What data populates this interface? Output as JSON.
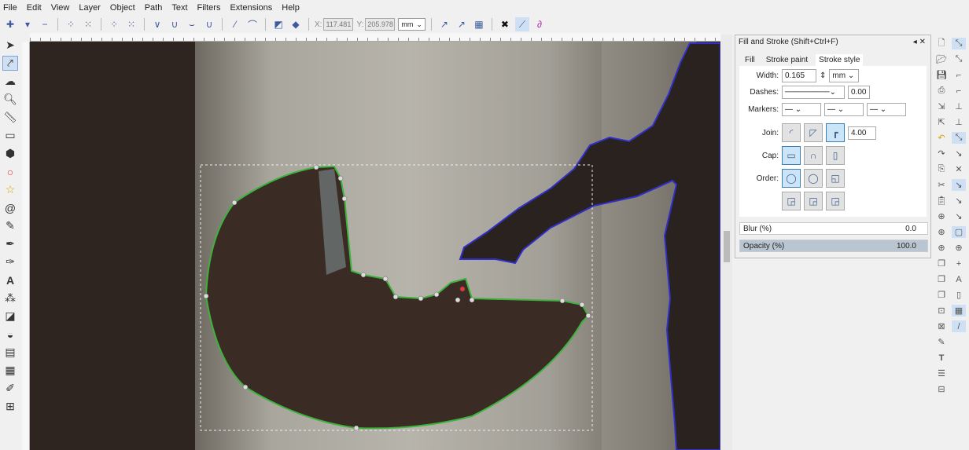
{
  "menu": [
    "File",
    "Edit",
    "View",
    "Layer",
    "Object",
    "Path",
    "Text",
    "Filters",
    "Extensions",
    "Help"
  ],
  "toolbar": {
    "x_label": "X:",
    "x_value": "117.481",
    "y_label": "Y:",
    "y_value": "205.978",
    "unit": "mm"
  },
  "panel": {
    "title": "Fill and Stroke (Shift+Ctrl+F)",
    "tabs": [
      "Fill",
      "Stroke paint",
      "Stroke style"
    ],
    "width_label": "Width:",
    "width_value": "0.165",
    "width_unit": "mm",
    "dashes_label": "Dashes:",
    "dashes_value": "0.00",
    "markers_label": "Markers:",
    "join_label": "Join:",
    "miter_value": "4.00",
    "cap_label": "Cap:",
    "order_label": "Order:",
    "blur_label": "Blur (%)",
    "blur_value": "0.0",
    "opacity_label": "Opacity (%)",
    "opacity_value": "100.0"
  },
  "colors": {
    "path_green": "#3db33d",
    "path_blue": "#3030c8",
    "accent": "#3c7fb1"
  }
}
